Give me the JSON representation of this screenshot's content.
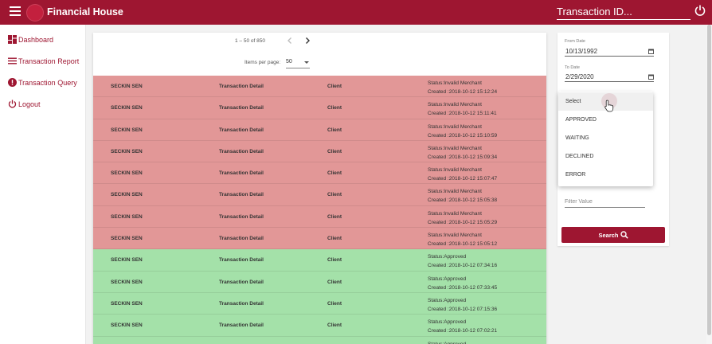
{
  "header": {
    "title": "Financial House",
    "search_placeholder": "Transaction ID..."
  },
  "sidebar": {
    "items": [
      {
        "label": "Dashboard",
        "icon": "dashboard-icon"
      },
      {
        "label": "Transaction Report",
        "icon": "list-icon"
      },
      {
        "label": "Transaction Query",
        "icon": "alert-icon"
      },
      {
        "label": "Logout",
        "icon": "power-icon"
      }
    ]
  },
  "paginator": {
    "range": "1 – 50 of 850",
    "items_per_page_label": "Items per page:",
    "items_per_page_value": "50"
  },
  "table": {
    "rows": [
      {
        "name": "SECKIN SEN",
        "detail": "Transaction Detail",
        "client": "Client",
        "status": "Status:Invalid Merchant",
        "created": "Created :2018-10-12 15:12:24",
        "state": "red"
      },
      {
        "name": "SECKIN SEN",
        "detail": "Transaction Detail",
        "client": "Client",
        "status": "Status:Invalid Merchant",
        "created": "Created :2018-10-12 15:11:41",
        "state": "red"
      },
      {
        "name": "SECKIN SEN",
        "detail": "Transaction Detail",
        "client": "Client",
        "status": "Status:Invalid Merchant",
        "created": "Created :2018-10-12 15:10:59",
        "state": "red"
      },
      {
        "name": "SECKIN SEN",
        "detail": "Transaction Detail",
        "client": "Client",
        "status": "Status:Invalid Merchant",
        "created": "Created :2018-10-12 15:09:34",
        "state": "red"
      },
      {
        "name": "SECKIN SEN",
        "detail": "Transaction Detail",
        "client": "Client",
        "status": "Status:Invalid Merchant",
        "created": "Created :2018-10-12 15:07:47",
        "state": "red"
      },
      {
        "name": "SECKIN SEN",
        "detail": "Transaction Detail",
        "client": "Client",
        "status": "Status:Invalid Merchant",
        "created": "Created :2018-10-12 15:05:38",
        "state": "red"
      },
      {
        "name": "SECKIN SEN",
        "detail": "Transaction Detail",
        "client": "Client",
        "status": "Status:Invalid Merchant",
        "created": "Created :2018-10-12 15:05:29",
        "state": "red"
      },
      {
        "name": "SECKIN SEN",
        "detail": "Transaction Detail",
        "client": "Client",
        "status": "Status:Invalid Merchant",
        "created": "Created :2018-10-12 15:05:12",
        "state": "red"
      },
      {
        "name": "SECKIN SEN",
        "detail": "Transaction Detail",
        "client": "Client",
        "status": "Status:Approved",
        "created": "Created :2018-10-12 07:34:16",
        "state": "green"
      },
      {
        "name": "SECKIN SEN",
        "detail": "Transaction Detail",
        "client": "Client",
        "status": "Status:Approved",
        "created": "Created :2018-10-12 07:33:45",
        "state": "green"
      },
      {
        "name": "SECKIN SEN",
        "detail": "Transaction Detail",
        "client": "Client",
        "status": "Status:Approved",
        "created": "Created :2018-10-12 07:15:36",
        "state": "green"
      },
      {
        "name": "SECKIN SEN",
        "detail": "Transaction Detail",
        "client": "Client",
        "status": "Status:Approved",
        "created": "Created :2018-10-12 07:02:21",
        "state": "green"
      },
      {
        "name": "",
        "detail": "",
        "client": "",
        "status": "Status:Approved",
        "created": "",
        "state": "green"
      }
    ]
  },
  "filters": {
    "from_date_label": "From Date",
    "from_date_value": "10/13/1992",
    "to_date_label": "To Date",
    "to_date_value": "2/29/2020",
    "status_options": [
      "Select",
      "APPROVED",
      "WAITING",
      "DECLINED",
      "ERROR"
    ],
    "filter_value_placeholder": "Filter Value",
    "search_button_label": "Search"
  },
  "colors": {
    "brand": "#9e1631",
    "row_error": "#e29797",
    "row_approved": "#a4e1a9"
  }
}
